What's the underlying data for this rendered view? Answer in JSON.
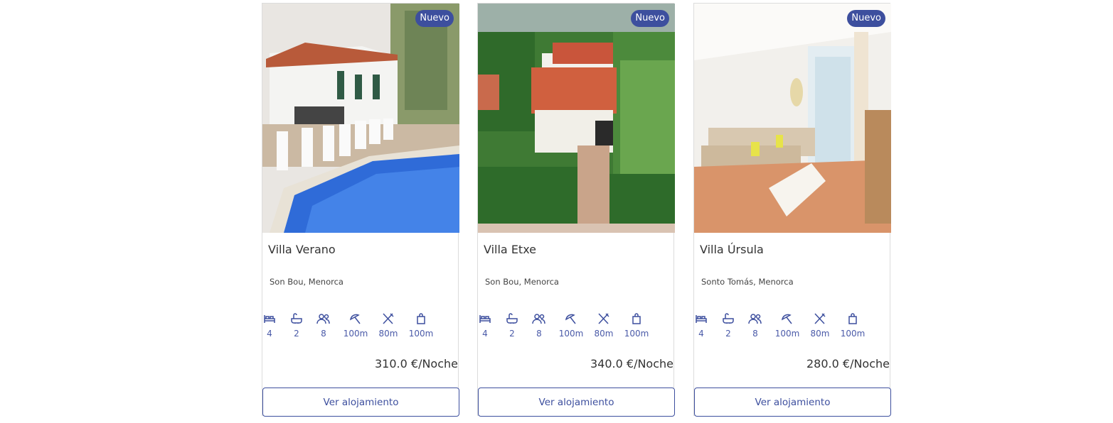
{
  "listings": [
    {
      "badge": "Nuevo",
      "name": "Villa Verano",
      "location": "Son Bou, Menorca",
      "amenities": {
        "bedrooms": "4",
        "bathrooms": "2",
        "guests": "8",
        "beach": "100m",
        "restaurant": "80m",
        "shop": "100m"
      },
      "price": "310.0 €/Noche",
      "button_label": "Ver alojamiento"
    },
    {
      "badge": "Nuevo",
      "name": "Villa Etxe",
      "location": "Son Bou, Menorca",
      "amenities": {
        "bedrooms": "4",
        "bathrooms": "2",
        "guests": "8",
        "beach": "100m",
        "restaurant": "80m",
        "shop": "100m"
      },
      "price": "340.0 €/Noche",
      "button_label": "Ver alojamiento"
    },
    {
      "badge": "Nuevo",
      "name": "Villa Úrsula",
      "location": "Sonto Tomás, Menorca",
      "amenities": {
        "bedrooms": "4",
        "bathrooms": "2",
        "guests": "8",
        "beach": "100m",
        "restaurant": "80m",
        "shop": "100m"
      },
      "price": "280.0 €/Noche",
      "button_label": "Ver alojamiento"
    }
  ],
  "icons": [
    "bed-icon",
    "bathtub-icon",
    "guests-icon",
    "beach-umbrella-icon",
    "restaurant-icon",
    "shopping-bag-icon"
  ],
  "colors": {
    "accent": "#3d4f9e",
    "badge_bg": "#3d4f9e",
    "amenity_text": "#4a5aa8"
  }
}
